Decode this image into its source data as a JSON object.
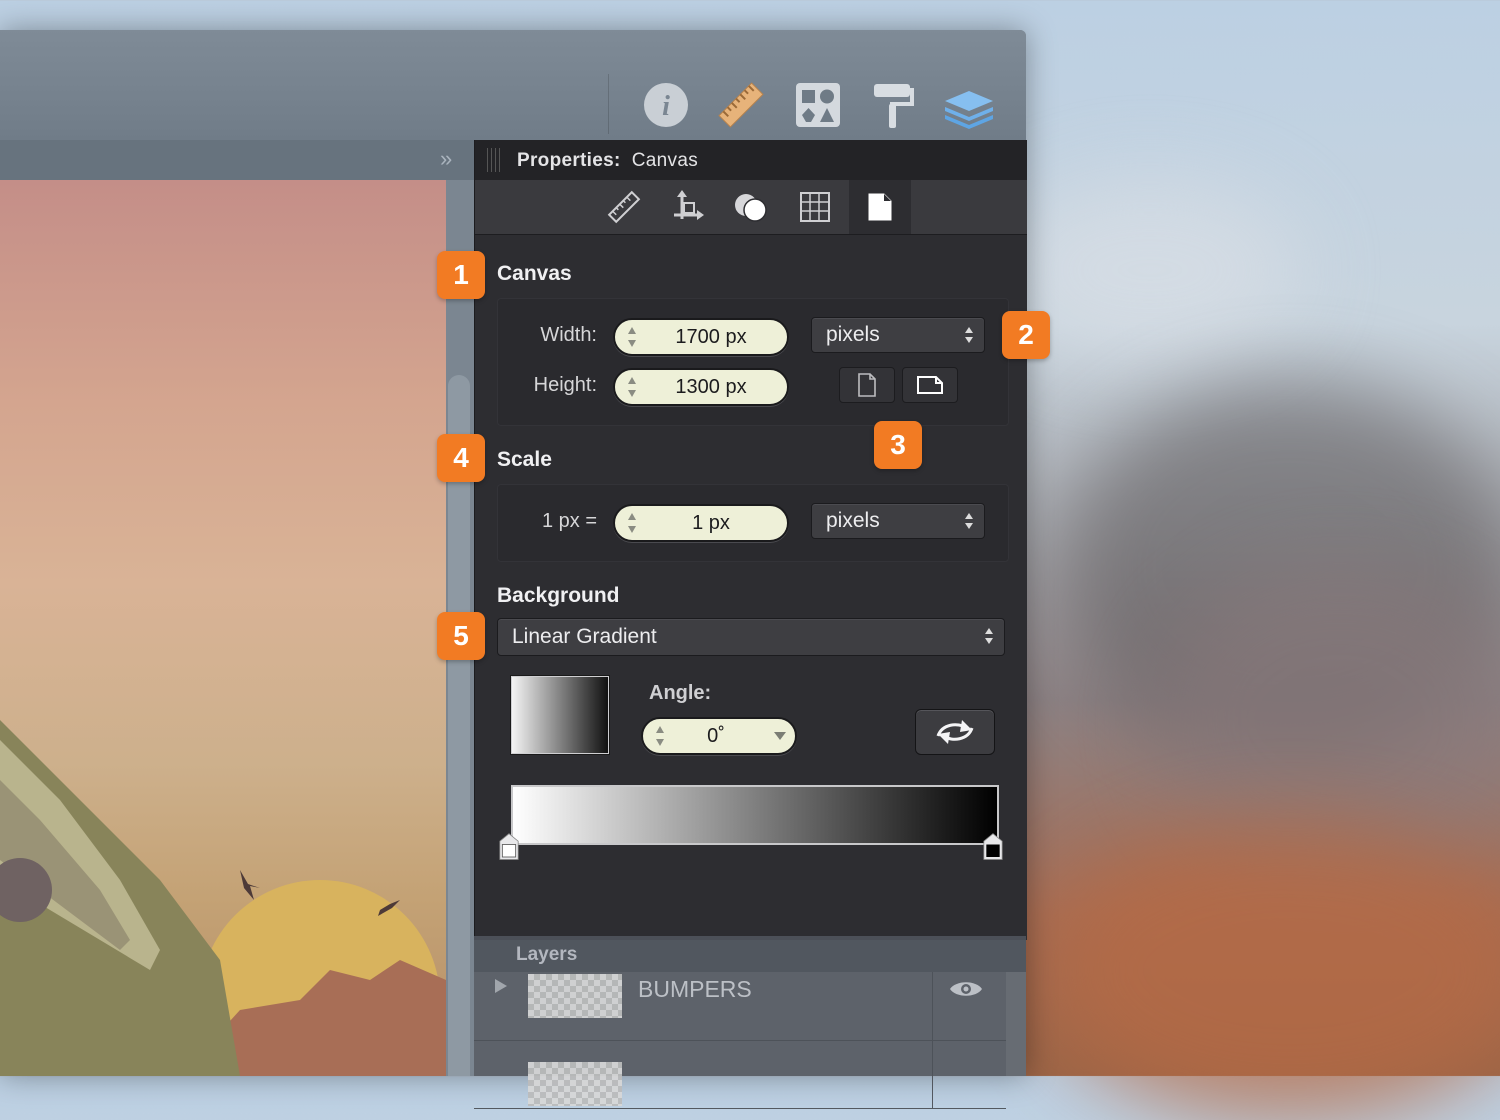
{
  "toolbar": {
    "studio_icons": [
      "info-icon",
      "ruler-icon",
      "shapes-icon",
      "paint-roller-icon",
      "layers-icon"
    ]
  },
  "properties": {
    "title_label": "Properties:",
    "title_value": "Canvas",
    "tabs": [
      "ruler-tab-icon",
      "transform-tab-icon",
      "fill-tab-icon",
      "grid-tab-icon",
      "document-tab-icon"
    ],
    "canvas": {
      "section": "Canvas",
      "width_label": "Width:",
      "width_value": "1700 px",
      "height_label": "Height:",
      "height_value": "1300 px",
      "unit": "pixels"
    },
    "scale": {
      "section": "Scale",
      "left_label": "1 px =",
      "value": "1 px",
      "unit": "pixels"
    },
    "background": {
      "section": "Background",
      "type": "Linear Gradient",
      "angle_label": "Angle:",
      "angle_value": "0˚",
      "gradient_start": "#ffffff",
      "gradient_end": "#000000"
    }
  },
  "badges": [
    "1",
    "2",
    "3",
    "4",
    "5"
  ],
  "layers": {
    "title": "Layers",
    "items": [
      {
        "name": "BUMPERS"
      },
      {
        "name": ""
      }
    ]
  },
  "colors": {
    "accent_badge": "#f27b23",
    "panel_bg": "#2d2d31",
    "field_bg": "#eef0d8"
  }
}
